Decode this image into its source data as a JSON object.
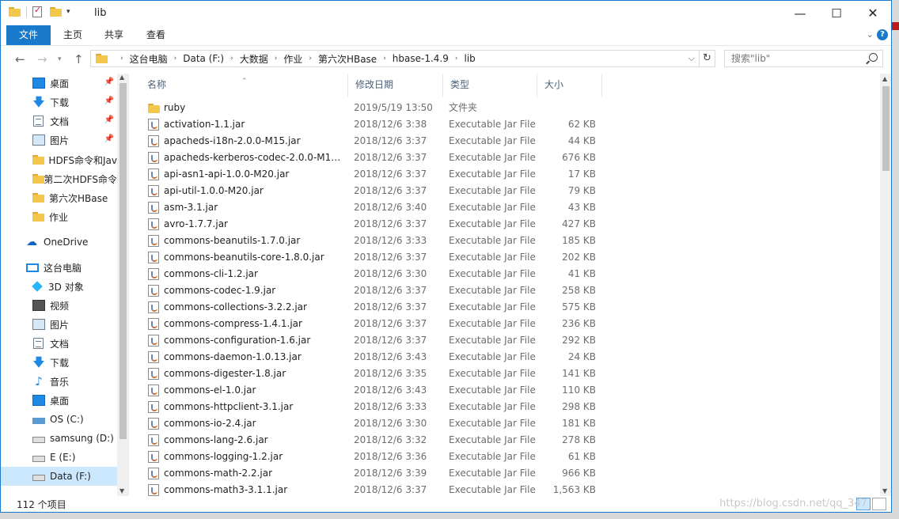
{
  "window": {
    "title": "lib"
  },
  "ribbon": {
    "tabs": [
      "文件",
      "主页",
      "共享",
      "查看"
    ],
    "help": "?"
  },
  "address": {
    "crumbs": [
      "这台电脑",
      "Data (F:)",
      "大数据",
      "作业",
      "第六次HBase",
      "hbase-1.4.9",
      "lib"
    ]
  },
  "search": {
    "placeholder": "搜索\"lib\""
  },
  "nav": {
    "items": [
      {
        "label": "桌面",
        "icon": "desktop-icon",
        "pinned": true
      },
      {
        "label": "下载",
        "icon": "download-icon",
        "pinned": true
      },
      {
        "label": "文档",
        "icon": "document-icon",
        "pinned": true
      },
      {
        "label": "图片",
        "icon": "picture-icon",
        "pinned": true
      },
      {
        "label": "HDFS命令和Jav",
        "icon": "folder-icon"
      },
      {
        "label": "第二次HDFS命令",
        "icon": "folder-icon"
      },
      {
        "label": "第六次HBase",
        "icon": "folder-icon"
      },
      {
        "label": "作业",
        "icon": "folder-icon"
      },
      {
        "label": "OneDrive",
        "icon": "onedrive-icon"
      },
      {
        "label": "这台电脑",
        "icon": "this-pc-icon"
      },
      {
        "label": "3D 对象",
        "icon": "3d-objects-icon"
      },
      {
        "label": "视频",
        "icon": "video-icon"
      },
      {
        "label": "图片",
        "icon": "picture-icon"
      },
      {
        "label": "文档",
        "icon": "document-icon"
      },
      {
        "label": "下载",
        "icon": "download-icon"
      },
      {
        "label": "音乐",
        "icon": "music-icon"
      },
      {
        "label": "桌面",
        "icon": "desktop-icon"
      },
      {
        "label": "OS (C:)",
        "icon": "os-drive-icon"
      },
      {
        "label": "samsung (D:)",
        "icon": "drive-icon"
      },
      {
        "label": "E (E:)",
        "icon": "drive-icon"
      },
      {
        "label": "Data (F:)",
        "icon": "drive-icon",
        "selected": true
      }
    ]
  },
  "columns": {
    "name": "名称",
    "date": "修改日期",
    "type": "类型",
    "size": "大小"
  },
  "files": [
    {
      "name": "ruby",
      "date": "2019/5/19 13:50",
      "type": "文件夹",
      "size": "",
      "kind": "folder"
    },
    {
      "name": "activation-1.1.jar",
      "date": "2018/12/6 3:38",
      "type": "Executable Jar File",
      "size": "62 KB",
      "kind": "jar"
    },
    {
      "name": "apacheds-i18n-2.0.0-M15.jar",
      "date": "2018/12/6 3:37",
      "type": "Executable Jar File",
      "size": "44 KB",
      "kind": "jar"
    },
    {
      "name": "apacheds-kerberos-codec-2.0.0-M15...",
      "date": "2018/12/6 3:37",
      "type": "Executable Jar File",
      "size": "676 KB",
      "kind": "jar"
    },
    {
      "name": "api-asn1-api-1.0.0-M20.jar",
      "date": "2018/12/6 3:37",
      "type": "Executable Jar File",
      "size": "17 KB",
      "kind": "jar"
    },
    {
      "name": "api-util-1.0.0-M20.jar",
      "date": "2018/12/6 3:37",
      "type": "Executable Jar File",
      "size": "79 KB",
      "kind": "jar"
    },
    {
      "name": "asm-3.1.jar",
      "date": "2018/12/6 3:40",
      "type": "Executable Jar File",
      "size": "43 KB",
      "kind": "jar"
    },
    {
      "name": "avro-1.7.7.jar",
      "date": "2018/12/6 3:37",
      "type": "Executable Jar File",
      "size": "427 KB",
      "kind": "jar"
    },
    {
      "name": "commons-beanutils-1.7.0.jar",
      "date": "2018/12/6 3:33",
      "type": "Executable Jar File",
      "size": "185 KB",
      "kind": "jar"
    },
    {
      "name": "commons-beanutils-core-1.8.0.jar",
      "date": "2018/12/6 3:37",
      "type": "Executable Jar File",
      "size": "202 KB",
      "kind": "jar"
    },
    {
      "name": "commons-cli-1.2.jar",
      "date": "2018/12/6 3:30",
      "type": "Executable Jar File",
      "size": "41 KB",
      "kind": "jar"
    },
    {
      "name": "commons-codec-1.9.jar",
      "date": "2018/12/6 3:37",
      "type": "Executable Jar File",
      "size": "258 KB",
      "kind": "jar"
    },
    {
      "name": "commons-collections-3.2.2.jar",
      "date": "2018/12/6 3:37",
      "type": "Executable Jar File",
      "size": "575 KB",
      "kind": "jar"
    },
    {
      "name": "commons-compress-1.4.1.jar",
      "date": "2018/12/6 3:37",
      "type": "Executable Jar File",
      "size": "236 KB",
      "kind": "jar"
    },
    {
      "name": "commons-configuration-1.6.jar",
      "date": "2018/12/6 3:37",
      "type": "Executable Jar File",
      "size": "292 KB",
      "kind": "jar"
    },
    {
      "name": "commons-daemon-1.0.13.jar",
      "date": "2018/12/6 3:43",
      "type": "Executable Jar File",
      "size": "24 KB",
      "kind": "jar"
    },
    {
      "name": "commons-digester-1.8.jar",
      "date": "2018/12/6 3:35",
      "type": "Executable Jar File",
      "size": "141 KB",
      "kind": "jar"
    },
    {
      "name": "commons-el-1.0.jar",
      "date": "2018/12/6 3:43",
      "type": "Executable Jar File",
      "size": "110 KB",
      "kind": "jar"
    },
    {
      "name": "commons-httpclient-3.1.jar",
      "date": "2018/12/6 3:33",
      "type": "Executable Jar File",
      "size": "298 KB",
      "kind": "jar"
    },
    {
      "name": "commons-io-2.4.jar",
      "date": "2018/12/6 3:30",
      "type": "Executable Jar File",
      "size": "181 KB",
      "kind": "jar"
    },
    {
      "name": "commons-lang-2.6.jar",
      "date": "2018/12/6 3:32",
      "type": "Executable Jar File",
      "size": "278 KB",
      "kind": "jar"
    },
    {
      "name": "commons-logging-1.2.jar",
      "date": "2018/12/6 3:36",
      "type": "Executable Jar File",
      "size": "61 KB",
      "kind": "jar"
    },
    {
      "name": "commons-math-2.2.jar",
      "date": "2018/12/6 3:39",
      "type": "Executable Jar File",
      "size": "966 KB",
      "kind": "jar"
    },
    {
      "name": "commons-math3-3.1.1.jar",
      "date": "2018/12/6 3:37",
      "type": "Executable Jar File",
      "size": "1,563 KB",
      "kind": "jar"
    }
  ],
  "status": {
    "count": "112 个项目"
  },
  "watermark": "https://blog.csdn.net/qq_347",
  "colors": {
    "accent": "#1979ca",
    "selection": "#cce8ff"
  }
}
